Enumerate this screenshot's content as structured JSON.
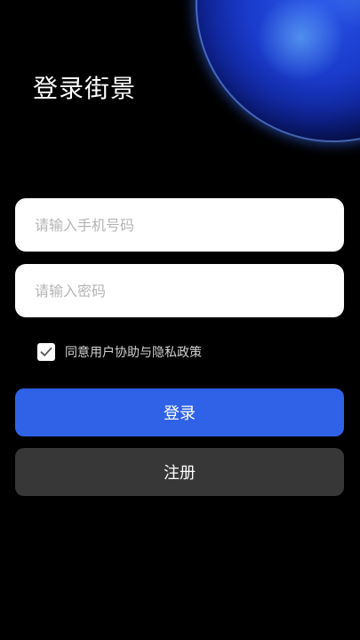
{
  "header": {
    "title": "登录街景"
  },
  "form": {
    "phone_placeholder": "请输入手机号码",
    "phone_value": "",
    "password_placeholder": "请输入密码",
    "password_value": ""
  },
  "agreement": {
    "checked": true,
    "text": "同意用户协助与隐私政策"
  },
  "buttons": {
    "login_label": "登录",
    "register_label": "注册"
  },
  "icons": {
    "checkbox": "check-icon",
    "decoration": "earth-planet-icon"
  },
  "colors": {
    "background": "#000000",
    "primary_button": "#2f62e6",
    "secondary_button": "#373737",
    "input_background": "#ffffff",
    "placeholder": "#b4b4b4",
    "planet": "#1a3bcc"
  }
}
